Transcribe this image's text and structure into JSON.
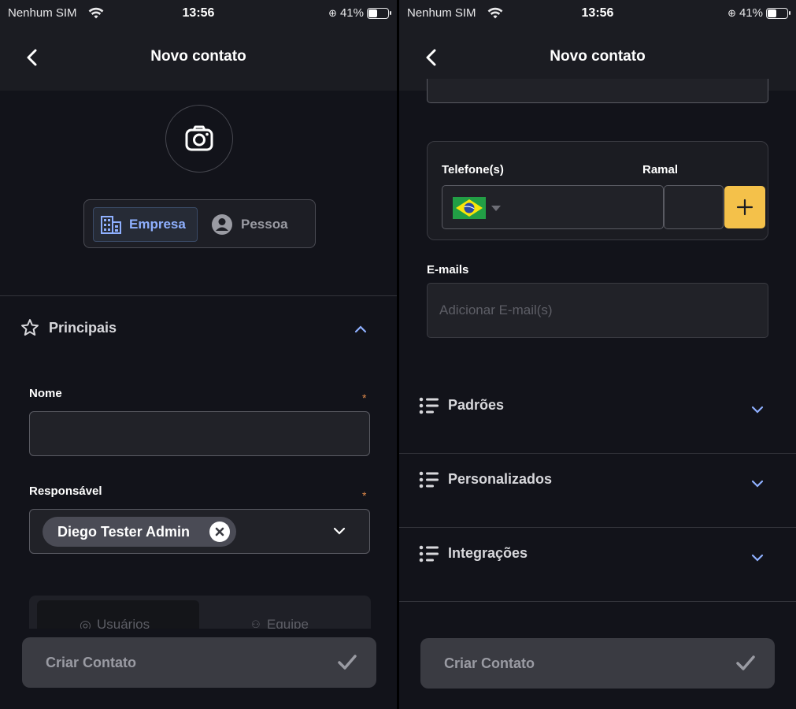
{
  "status_bar": {
    "carrier": "Nenhum SIM",
    "time": "13:56",
    "battery": "41%",
    "battery_level": 0.41
  },
  "header": {
    "title": "Novo contato",
    "back_icon": "chevron-left-icon"
  },
  "left": {
    "photo_icon": "camera-icon",
    "type_toggle": {
      "options": [
        {
          "label": "Empresa",
          "icon": "building-icon",
          "selected": true
        },
        {
          "label": "Pessoa",
          "icon": "person-icon",
          "selected": false
        }
      ]
    },
    "section": {
      "label": "Principais",
      "icon": "star-icon",
      "expanded": true
    },
    "fields": {
      "nome": {
        "label": "Nome",
        "required_mark": "*",
        "value": ""
      },
      "responsavel": {
        "label": "Responsável",
        "required_mark": "*",
        "chip": "Diego Tester Admin"
      }
    },
    "tabs": [
      "Usuários",
      "Equipe"
    ]
  },
  "right": {
    "phone": {
      "label": "Telefone(s)",
      "ext_label": "Ramal",
      "country": "Brasil",
      "add_icon": "plus-icon"
    },
    "emails": {
      "label": "E-mails",
      "placeholder": "Adicionar E-mail(s)"
    },
    "sections": [
      {
        "label": "Padrões",
        "icon": "list-icon",
        "expanded": false
      },
      {
        "label": "Personalizados",
        "icon": "list-icon",
        "expanded": false
      },
      {
        "label": "Integrações",
        "icon": "list-icon",
        "expanded": false
      }
    ]
  },
  "footer": {
    "create_label": "Criar Contato",
    "check_icon": "check-icon"
  },
  "colors": {
    "background": "#12131a",
    "header": "#1b1c22",
    "accent_blue": "#8fb0ff",
    "accent_yellow": "#f4c14a",
    "required": "#e08a4a"
  }
}
